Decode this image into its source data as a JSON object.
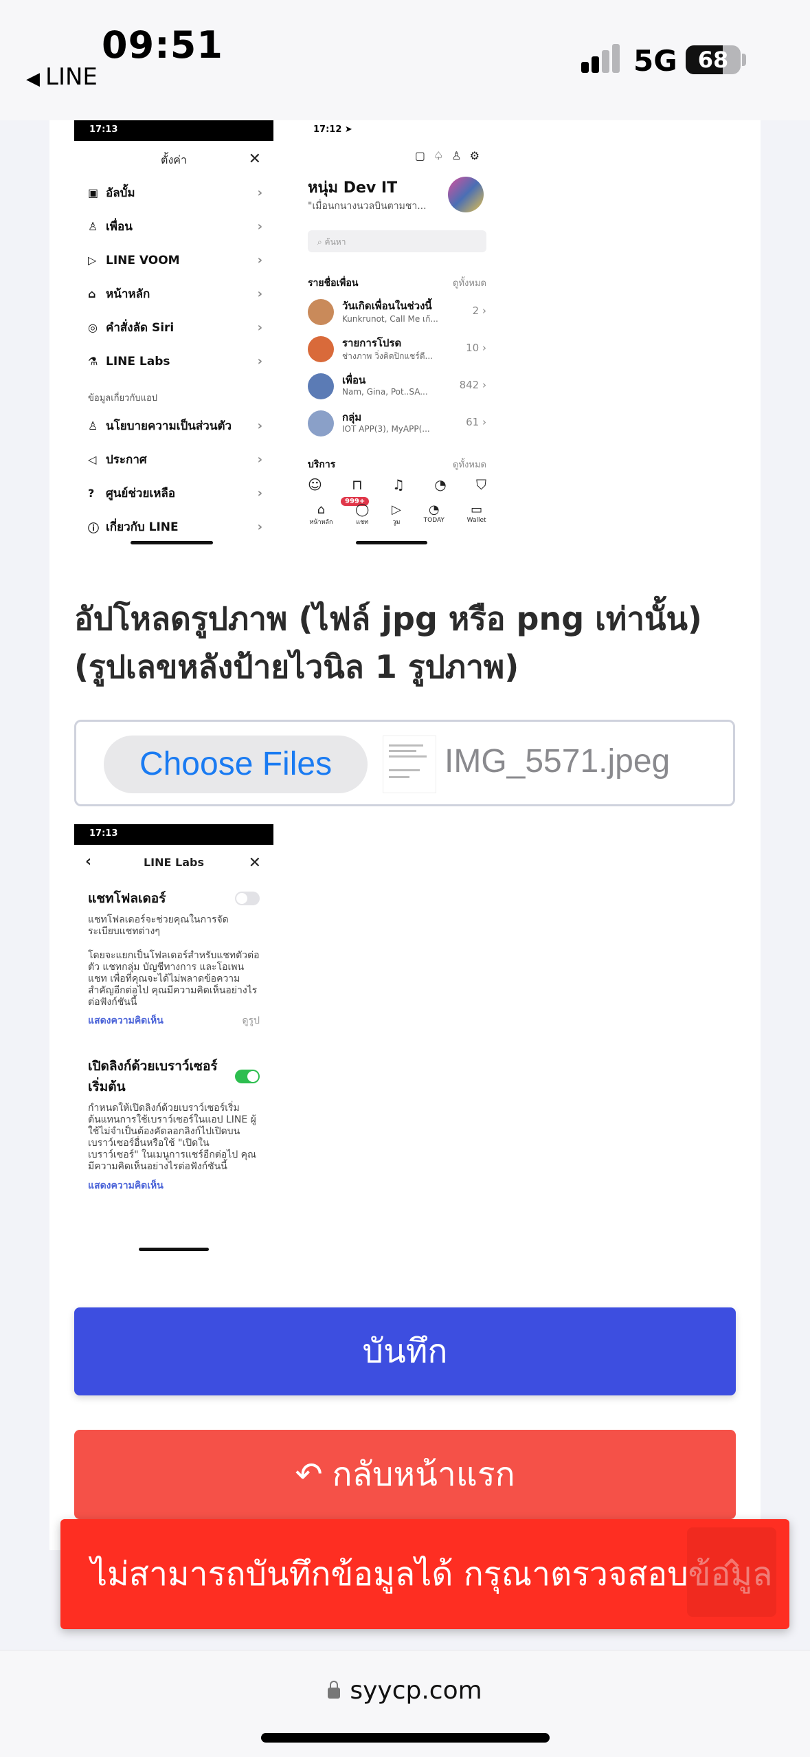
{
  "status_bar": {
    "time": "09:51",
    "back_label": "LINE",
    "network": "5G",
    "battery": "68",
    "battery_level": 0.68
  },
  "thumb1": {
    "time": "17:13",
    "title": "ตั้งค่า",
    "rows": [
      {
        "icon": "▣",
        "label": "อัลบั้ม"
      },
      {
        "icon": "♙",
        "label": "เพื่อน"
      },
      {
        "icon": "▷",
        "label": "LINE VOOM"
      },
      {
        "icon": "⌂",
        "label": "หน้าหลัก"
      },
      {
        "icon": "◎",
        "label": "คำสั่งลัด Siri"
      },
      {
        "icon": "⚗",
        "label": "LINE Labs"
      }
    ],
    "section": "ข้อมูลเกี่ยวกับแอป",
    "rows2": [
      {
        "icon": "♙",
        "label": "นโยบายความเป็นส่วนตัว"
      },
      {
        "icon": "◁",
        "label": "ประกาศ"
      },
      {
        "icon": "?",
        "label": "ศูนย์ช่วยเหลือ"
      },
      {
        "icon": "ⓘ",
        "label": "เกี่ยวกับ LINE"
      }
    ]
  },
  "thumb2": {
    "time": "17:12",
    "profile_name": "หนุ่ม Dev IT",
    "profile_status": "\"เมื่อนกนางนวลบินตามชา...",
    "search_placeholder": "ค้นหา",
    "friends_header": "รายชื่อเพื่อน",
    "see_all": "ดูทั้งหมด",
    "friends": [
      {
        "name": "วันเกิดเพื่อนในช่วงนี้",
        "sub": "Kunkrunot, Call Me เก้...",
        "count": "2"
      },
      {
        "name": "รายการโปรด",
        "sub": "ช่างภาพ วิ่งคิดปิกแชร์ดี...",
        "count": "10"
      },
      {
        "name": "เพื่อน",
        "sub": "Nam, Gina, Pot..SA...",
        "count": "842"
      },
      {
        "name": "กลุ่ม",
        "sub": "IOT APP(3), MyAPP(...",
        "count": "61"
      }
    ],
    "services_header": "บริการ",
    "tabs": [
      {
        "icon": "⌂",
        "label": "หน้าหลัก"
      },
      {
        "icon": "◯",
        "label": "แชท"
      },
      {
        "icon": "▷",
        "label": "วูม"
      },
      {
        "icon": "◔",
        "label": "TODAY"
      },
      {
        "icon": "▭",
        "label": "Wallet"
      }
    ],
    "badge": "999+"
  },
  "upload": {
    "label": "อัปโหลดรูปภาพ (ไฟล์ jpg หรือ png เท่านั้น) (รูปเลขหลังป้ายไวนิล 1 รูปภาพ)",
    "choose_button": "Choose Files",
    "file_name": "IMG_5571.jpeg"
  },
  "thumb3": {
    "time": "17:13",
    "title": "LINE Labs",
    "item1_title": "แชทโฟลเดอร์",
    "item1_desc": "แชทโฟลเดอร์จะช่วยคุณในการจัดระเบียบแชทต่างๆ",
    "item1_desc2": "โดยจะแยกเป็นโฟลเดอร์สำหรับแชทตัวต่อตัว แชทกลุ่ม บัญชีทางการ และโอเพนแชท เพื่อที่คุณจะได้ไม่พลาดข้อความสำคัญอีกต่อไป คุณมีความคิดเห็นอย่างไรต่อฟังก์ชันนี้",
    "item1_link": "แสดงความคิดเห็น",
    "item1_link_right": "ดูรูป",
    "item2_title": "เปิดลิงก์ด้วยเบราว์เซอร์เริ่มต้น",
    "item2_desc": "กำหนดให้เปิดลิงก์ด้วยเบราว์เซอร์เริ่มต้นแทนการใช้เบราว์เซอร์ในแอป LINE ผู้ใช้ไม่จำเป็นต้องคัดลอกลิงก์ไปเปิดบนเบราว์เซอร์อื่นหรือใช้ \"เปิดในเบราว์เซอร์\" ในเมนูการแชร์อีกต่อไป คุณมีความคิดเห็นอย่างไรต่อฟังก์ชันนี้",
    "item2_link": "แสดงความคิดเห็น"
  },
  "buttons": {
    "save": "บันทึก",
    "back": "กลับหน้าแรก"
  },
  "toast": {
    "message": "ไม่สามารถบันทึกข้อมูลได้ กรุณาตรวจสอบข้อมูล"
  },
  "browser": {
    "url": "syycp.com"
  }
}
